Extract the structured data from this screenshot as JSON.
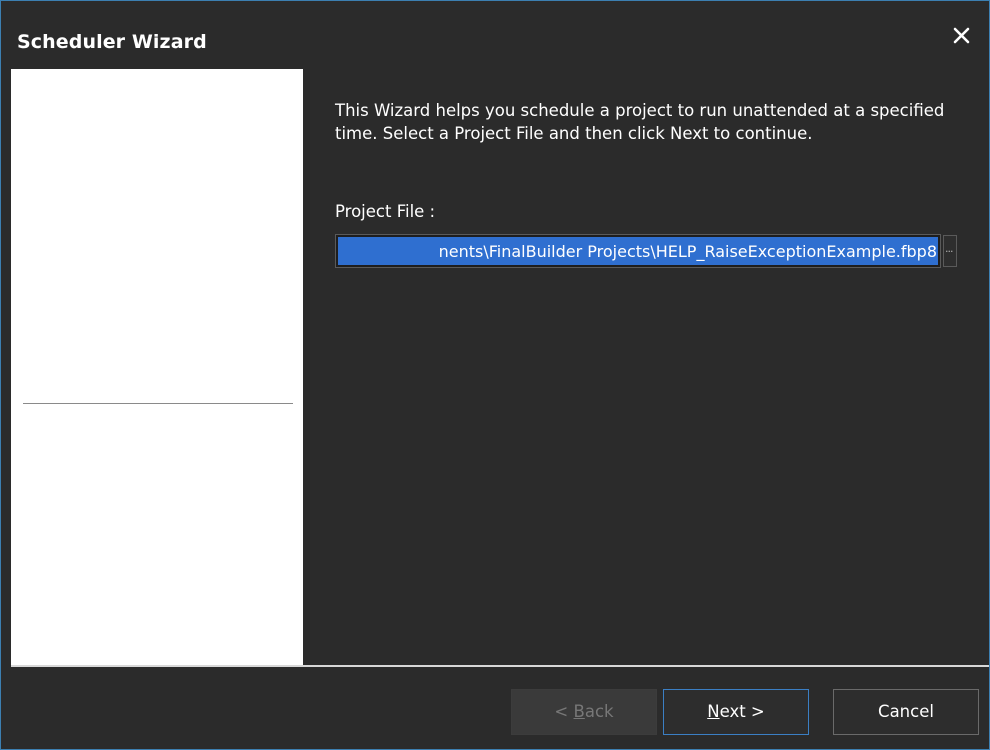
{
  "window": {
    "title": "Scheduler Wizard",
    "close_icon": "close-icon"
  },
  "content": {
    "intro_text": "This Wizard helps you schedule a project to run unattended at a specified time. Select a Project File and then click Next to continue.",
    "project_file_label": "Project File :",
    "project_file_value": "nents\\FinalBuilder Projects\\HELP_RaiseExceptionExample.fbp8",
    "browse_label": "..."
  },
  "buttons": {
    "back_prefix": "< ",
    "back_mnemonic": "B",
    "back_rest": "ack",
    "next_mnemonic": "N",
    "next_rest": "ext >",
    "cancel": "Cancel"
  },
  "colors": {
    "background": "#2b2b2b",
    "side_panel": "#ffffff",
    "selection": "#2f6fd0",
    "accent_border": "#3b7fc4"
  }
}
